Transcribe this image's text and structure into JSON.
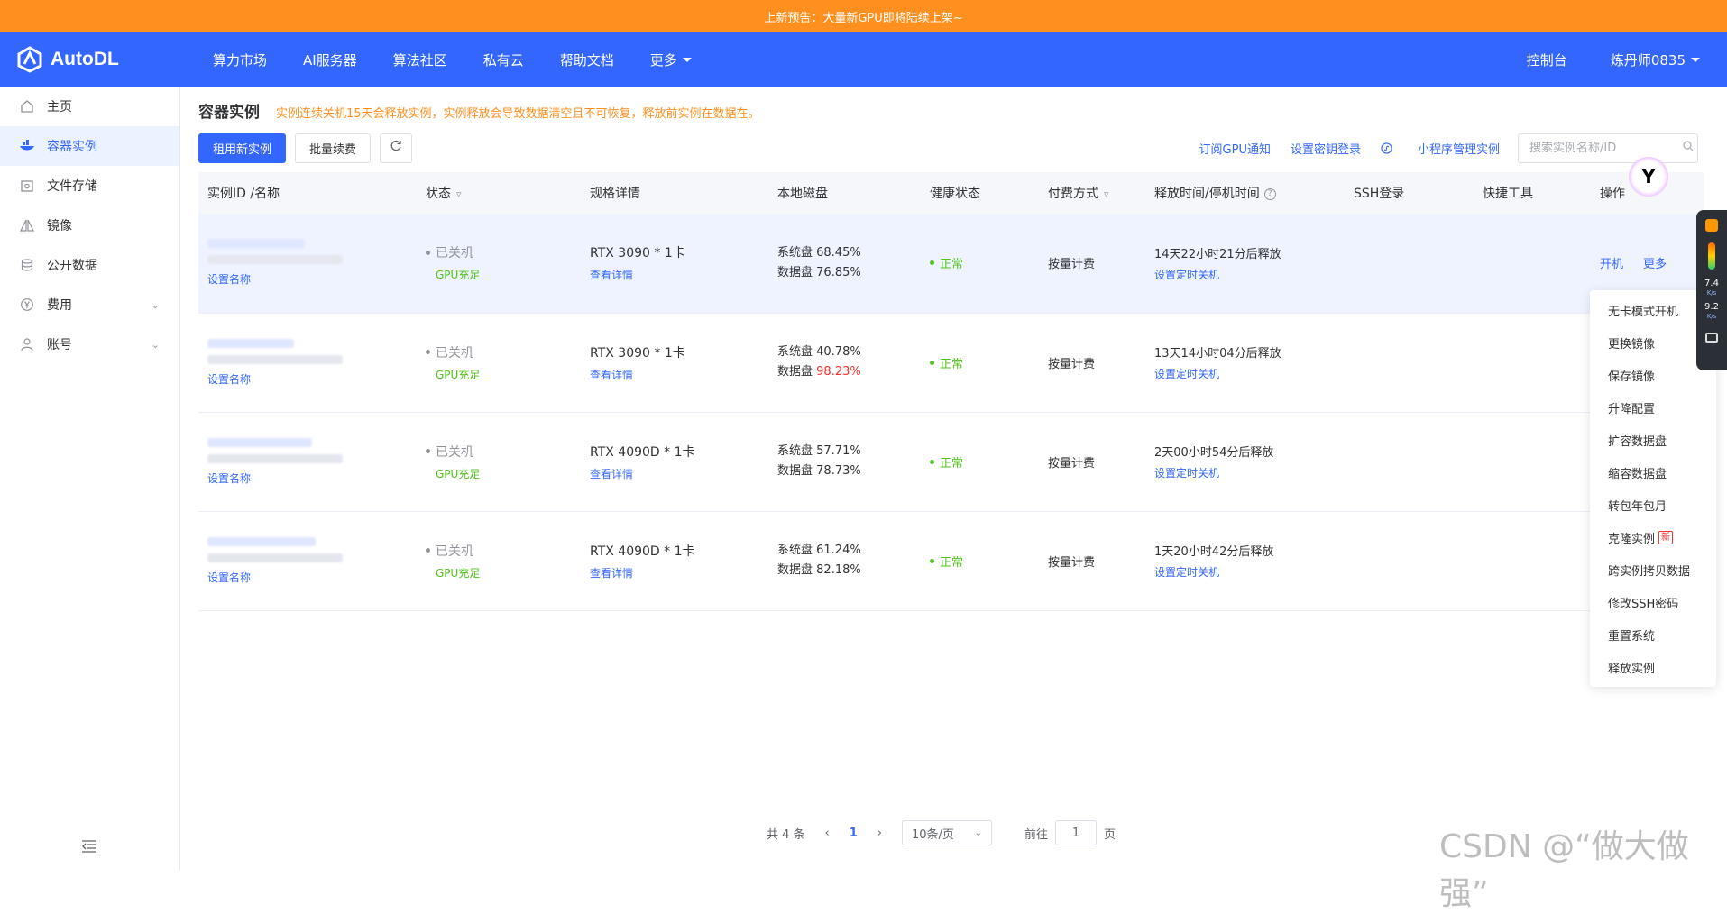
{
  "banner": {
    "text": "上新预告：大量新GPU即将陆续上架~"
  },
  "brand": {
    "name": "AutoDL"
  },
  "nav": {
    "items": [
      "算力市场",
      "AI服务器",
      "算法社区",
      "私有云",
      "帮助文档",
      "更多"
    ],
    "console": "控制台",
    "user": "炼丹师0835"
  },
  "sidebar": {
    "items": [
      {
        "label": "主页",
        "icon": "home-icon"
      },
      {
        "label": "容器实例",
        "icon": "container-icon"
      },
      {
        "label": "文件存储",
        "icon": "storage-icon"
      },
      {
        "label": "镜像",
        "icon": "image-icon"
      },
      {
        "label": "公开数据",
        "icon": "database-icon"
      },
      {
        "label": "费用",
        "icon": "yen-icon"
      },
      {
        "label": "账号",
        "icon": "user-icon"
      }
    ]
  },
  "page": {
    "title": "容器实例",
    "warning": "实例连续关机15天会释放实例，实例释放会导致数据清空且不可恢复，释放前实例在数据在。"
  },
  "toolbar": {
    "rent": "租用新实例",
    "renew": "批量续费",
    "subscribe": "订阅GPU通知",
    "key_login": "设置密钥登录",
    "mini_program": "小程序管理实例",
    "search_placeholder": "搜索实例名称/ID"
  },
  "table": {
    "headers": [
      "实例ID /名称",
      "状态",
      "规格详情",
      "本地磁盘",
      "健康状态",
      "付费方式",
      "释放时间/停机时间",
      "SSH登录",
      "快捷工具",
      "操作"
    ],
    "rows": [
      {
        "set_name": "设置名称",
        "status": "已关机",
        "gpu": "GPU充足",
        "spec": "RTX 3090 * 1卡",
        "detail": "查看详情",
        "sys_disk": "系统盘 68.45%",
        "data_disk_label": "数据盘",
        "data_disk_value": "76.85%",
        "health": "正常",
        "billing": "按量计费",
        "release": "14天22小时21分后释放",
        "shutdown": "设置定时关机",
        "op_start": "开机",
        "op_more": "更多"
      },
      {
        "set_name": "设置名称",
        "status": "已关机",
        "gpu": "GPU充足",
        "spec": "RTX 3090 * 1卡",
        "detail": "查看详情",
        "sys_disk": "系统盘 40.78%",
        "data_disk_label": "数据盘",
        "data_disk_value": "98.23%",
        "health": "正常",
        "billing": "按量计费",
        "release": "13天14小时04分后释放",
        "shutdown": "设置定时关机"
      },
      {
        "set_name": "设置名称",
        "status": "已关机",
        "gpu": "GPU充足",
        "spec": "RTX 4090D * 1卡",
        "detail": "查看详情",
        "sys_disk": "系统盘 57.71%",
        "data_disk_label": "数据盘",
        "data_disk_value": "78.73%",
        "health": "正常",
        "billing": "按量计费",
        "release": "2天00小时54分后释放",
        "shutdown": "设置定时关机"
      },
      {
        "set_name": "设置名称",
        "status": "已关机",
        "gpu": "GPU充足",
        "spec": "RTX 4090D * 1卡",
        "detail": "查看详情",
        "sys_disk": "系统盘 61.24%",
        "data_disk_label": "数据盘",
        "data_disk_value": "82.18%",
        "health": "正常",
        "billing": "按量计费",
        "release": "1天20小时42分后释放",
        "shutdown": "设置定时关机"
      }
    ]
  },
  "menu": {
    "items": [
      "无卡模式开机",
      "更换镜像",
      "保存镜像",
      "升降配置",
      "扩容数据盘",
      "缩容数据盘",
      "转包年包月",
      "克隆实例",
      "跨实例拷贝数据",
      "修改SSH密码",
      "重置系统",
      "释放实例"
    ],
    "new_tag": "新"
  },
  "pager": {
    "total": "共 4 条",
    "current": "1",
    "size": "10条/页",
    "goto": "前往",
    "goto_value": "1",
    "page_unit": "页"
  },
  "floatbar": {
    "down": "7.4",
    "up": "9.2",
    "unit": "K/s"
  },
  "watermark": "CSDN @“做大做强”",
  "colors": {
    "primary": "#3366ff",
    "banner": "#ff8f1f",
    "success": "#52c41a",
    "danger": "#ff2d2d"
  }
}
